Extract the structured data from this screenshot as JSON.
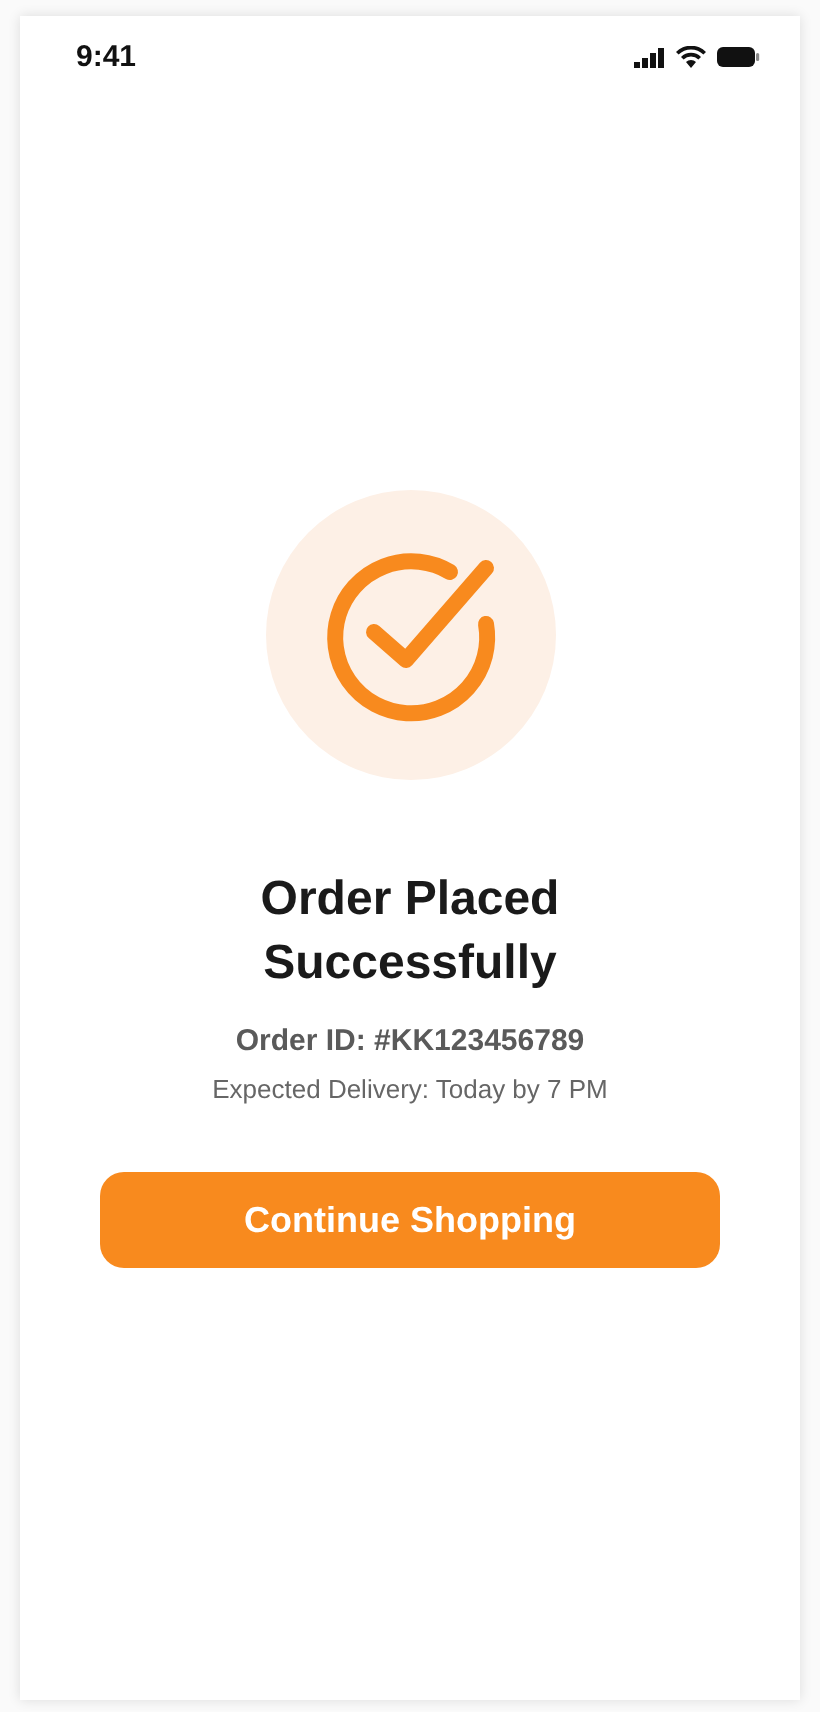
{
  "status_bar": {
    "time": "9:41"
  },
  "confirmation": {
    "title": "Order Placed Successfully",
    "order_id": "Order ID: #KK123456789",
    "delivery": "Expected Delivery: Today by 7 PM"
  },
  "buttons": [
    {
      "label": "Continue Shopping"
    }
  ]
}
